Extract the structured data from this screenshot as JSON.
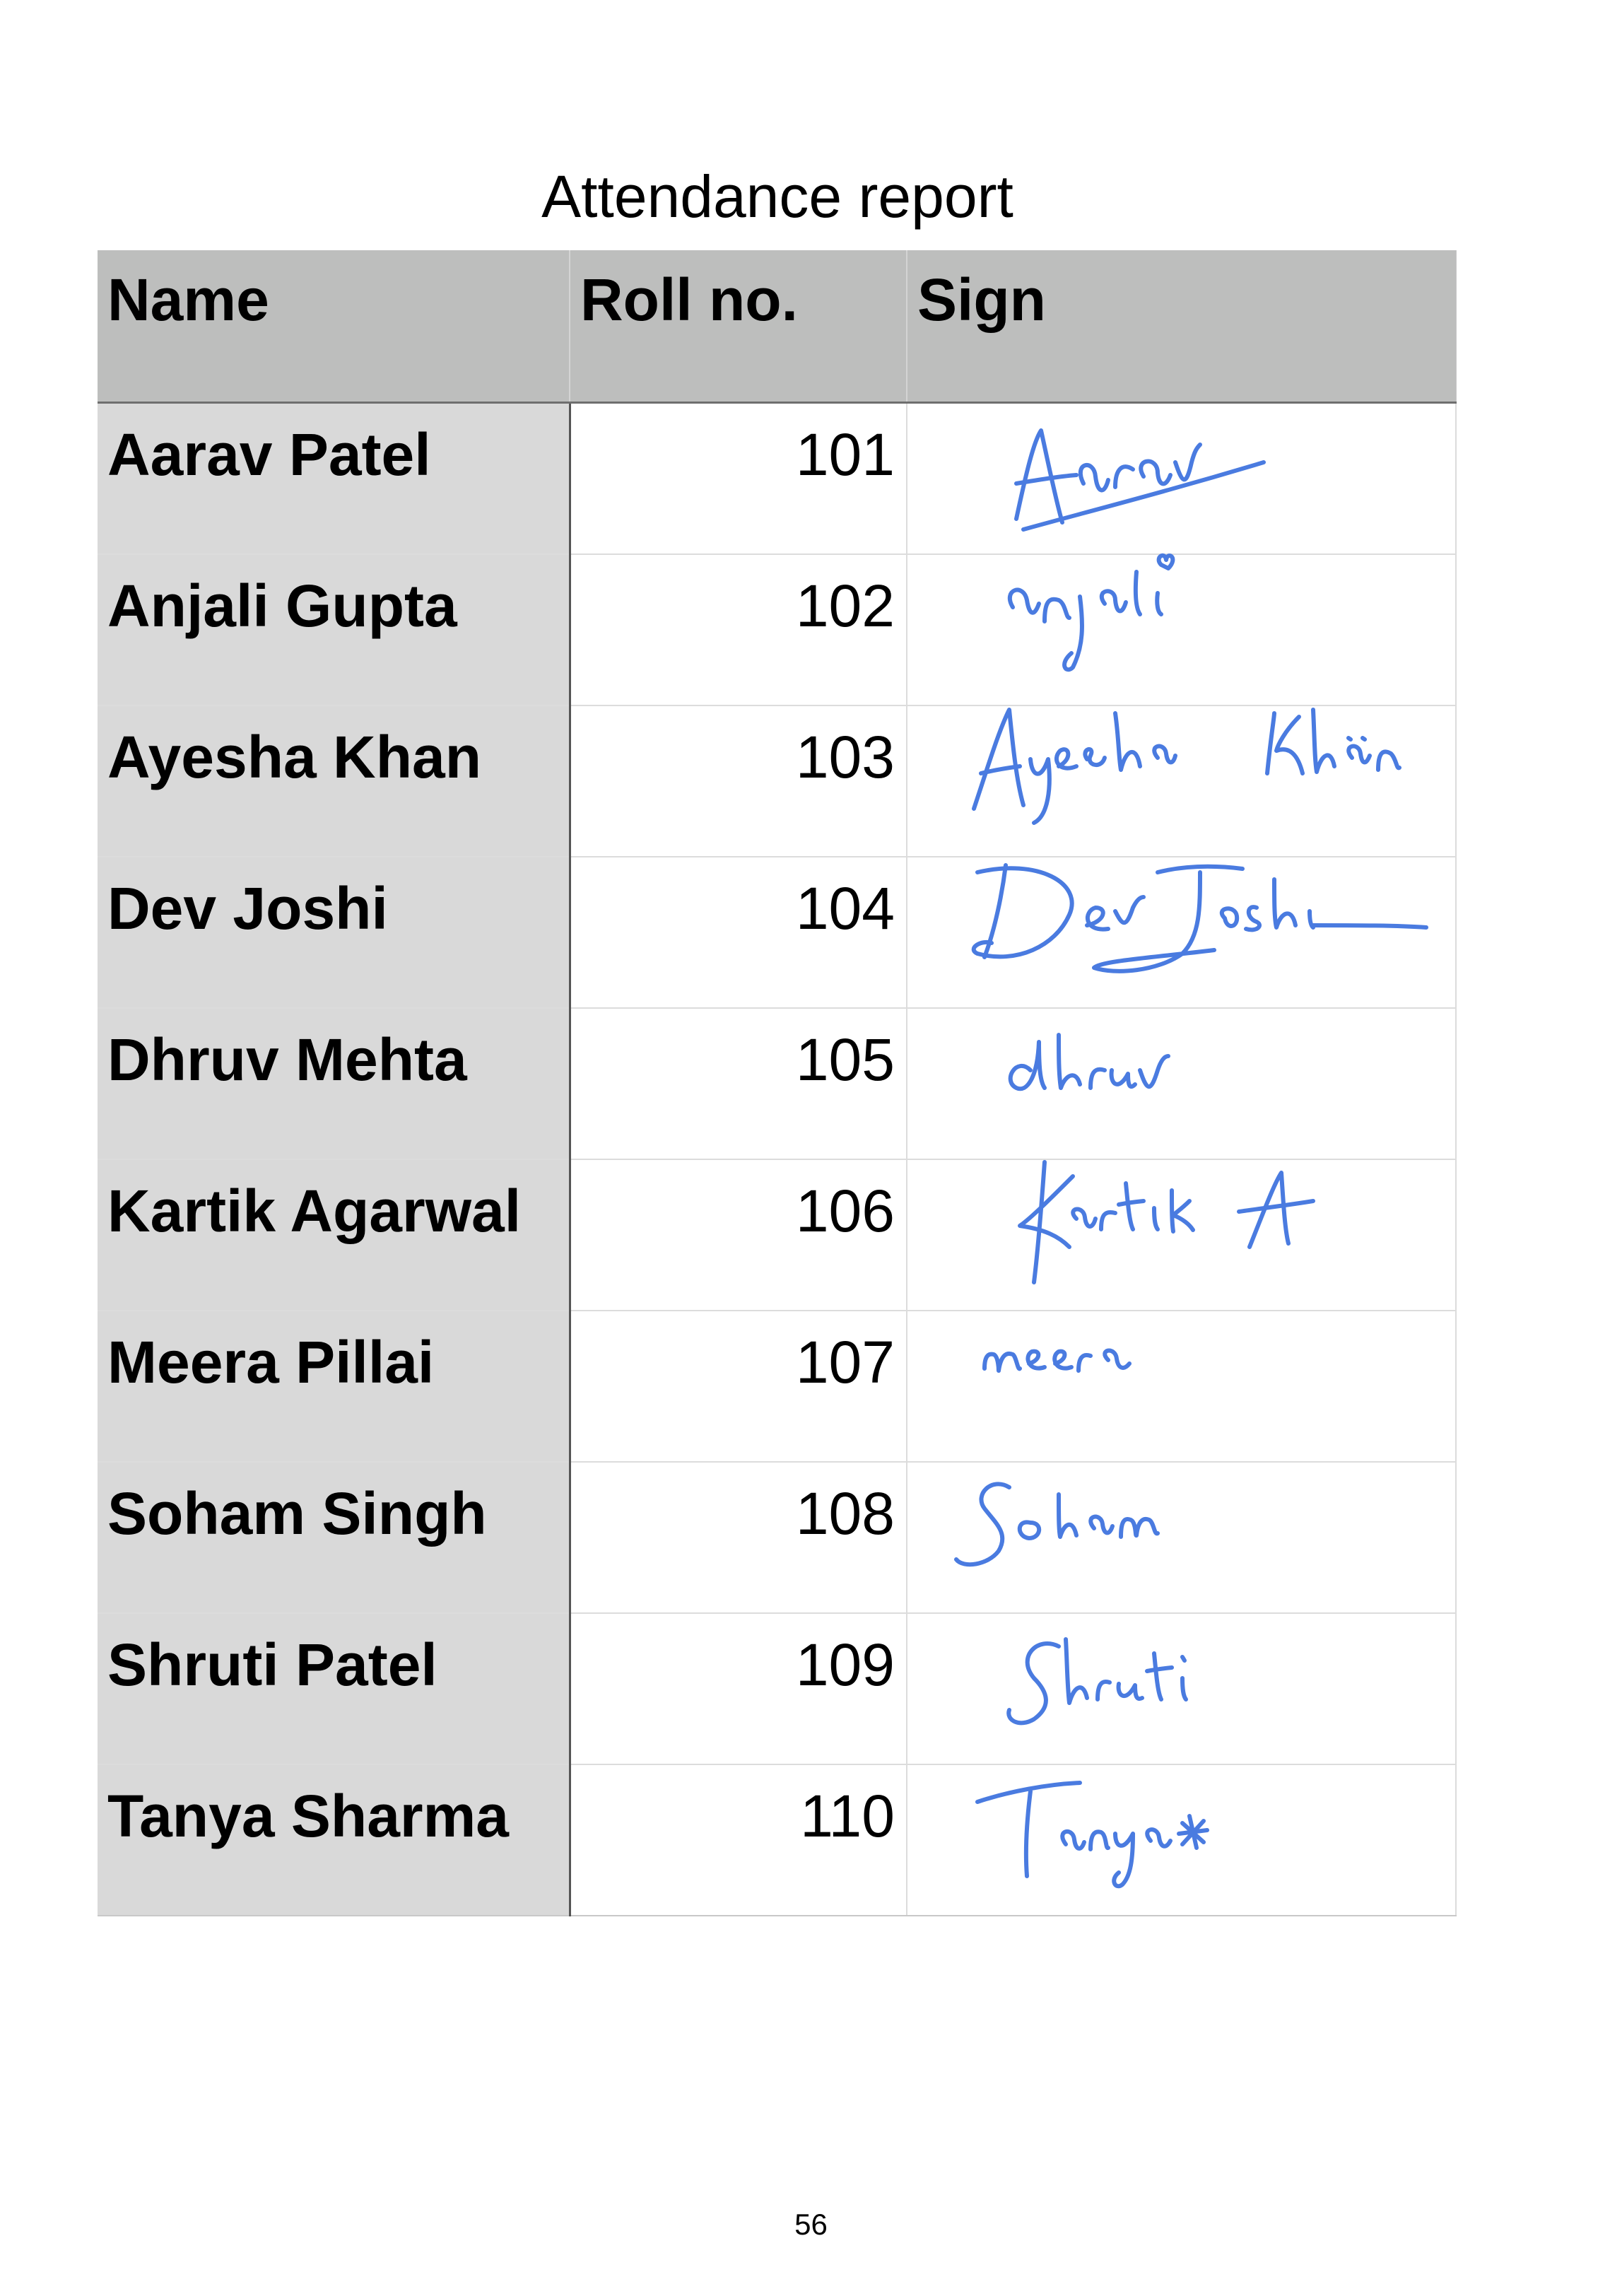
{
  "title": "Attendance report",
  "table": {
    "headers": {
      "name": "Name",
      "roll": "Roll no.",
      "sign": "Sign"
    },
    "rows": [
      {
        "name": "Aarav Patel",
        "roll": "101",
        "signature": "Aarav"
      },
      {
        "name": "Anjali Gupta",
        "roll": "102",
        "signature": "anjali"
      },
      {
        "name": "Ayesha Khan",
        "roll": "103",
        "signature": "Ayesha Khan"
      },
      {
        "name": "Dev Joshi",
        "roll": "104",
        "signature": "Dev Joshi"
      },
      {
        "name": "Dhruv Mehta",
        "roll": "105",
        "signature": "dhruv"
      },
      {
        "name": "Kartik Agarwal",
        "roll": "106",
        "signature": "Kartik A"
      },
      {
        "name": "Meera Pillai",
        "roll": "107",
        "signature": "meera"
      },
      {
        "name": "Soham Singh",
        "roll": "108",
        "signature": "Soham"
      },
      {
        "name": "Shruti Patel",
        "roll": "109",
        "signature": "Shruti"
      },
      {
        "name": "Tanya Sharma",
        "roll": "110",
        "signature": "Tanya"
      }
    ]
  },
  "signature_color": "#4a7be0",
  "page_number": "56"
}
